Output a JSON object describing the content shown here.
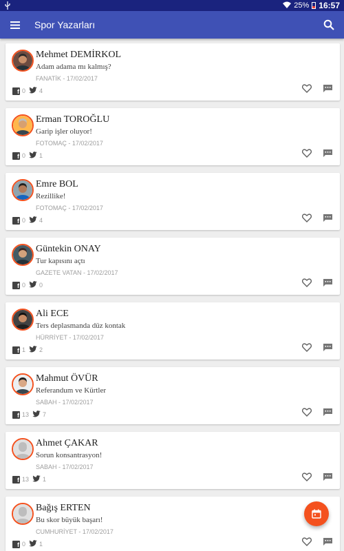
{
  "status_bar": {
    "battery_percent": "25%",
    "time": "16:57"
  },
  "app_bar": {
    "title": "Spor Yazarları",
    "menu_icon": "hamburger-menu-icon",
    "search_icon": "search-icon"
  },
  "colors": {
    "status_bar": "#1a237e",
    "app_bar": "#3f51b5",
    "accent": "#f4511e",
    "background": "#eeeeee"
  },
  "columns": [
    {
      "author": "Mehmet DEMİRKOL",
      "headline": "Adam adama mı kalmış?",
      "source": "FANATİK - 17/02/2017",
      "facebook_count": "0",
      "twitter_count": "4",
      "avatar": {
        "bg": "#6d4c41",
        "face": "#c8906b",
        "hair": "#2b2b2b",
        "shirt": "#263238"
      }
    },
    {
      "author": "Erman TOROĞLU",
      "headline": "Garip işler oluyor!",
      "source": "FOTOMAÇ - 17/02/2017",
      "facebook_count": "0",
      "twitter_count": "1",
      "avatar": {
        "bg": "#ffb74d",
        "face": "#d7a070",
        "hair": "#bdbdbd",
        "shirt": "#37474f"
      }
    },
    {
      "author": "Emre BOL",
      "headline": "Rezillike!",
      "source": "FOTOMAÇ - 17/02/2017",
      "facebook_count": "0",
      "twitter_count": "4",
      "avatar": {
        "bg": "#90a4ae",
        "face": "#b07a5a",
        "hair": "#212121",
        "shirt": "#1565c0"
      }
    },
    {
      "author": "Güntekin ONAY",
      "headline": "Tur kapısını açtı",
      "source": "GAZETE VATAN - 17/02/2017",
      "facebook_count": "0",
      "twitter_count": "0",
      "avatar": {
        "bg": "#455a64",
        "face": "#d2a27c",
        "hair": "#3e2723",
        "shirt": "#263238"
      }
    },
    {
      "author": "Ali ECE",
      "headline": "Ters deplasmanda düz kontak",
      "source": "HÜRRİYET - 17/02/2017",
      "facebook_count": "1",
      "twitter_count": "2",
      "avatar": {
        "bg": "#424242",
        "face": "#c68c66",
        "hair": "#111111",
        "shirt": "#212121"
      }
    },
    {
      "author": "Mahmut ÖVÜR",
      "headline": "Referandum ve Kürtler",
      "source": "SABAH - 17/02/2017",
      "facebook_count": "13",
      "twitter_count": "7",
      "avatar": {
        "bg": "#eceff1",
        "face": "#d9a886",
        "hair": "#212121",
        "shirt": "#37474f"
      }
    },
    {
      "author": "Ahmet ÇAKAR",
      "headline": "Sorun konsantrasyon!",
      "source": "SABAH - 17/02/2017",
      "facebook_count": "13",
      "twitter_count": "1",
      "avatar": {
        "bg": "#e0e0e0",
        "face": "#bdbdbd",
        "hair": "#bdbdbd",
        "shirt": "#bdbdbd"
      }
    },
    {
      "author": "Bağış ERTEN",
      "headline": "Bu skor büyük başarı!",
      "source": "CUMHURİYET - 17/02/2017",
      "facebook_count": "0",
      "twitter_count": "1",
      "avatar": {
        "bg": "#e0e0e0",
        "face": "#bdbdbd",
        "hair": "#bdbdbd",
        "shirt": "#bdbdbd"
      }
    }
  ],
  "fab": {
    "icon": "calendar-icon"
  }
}
